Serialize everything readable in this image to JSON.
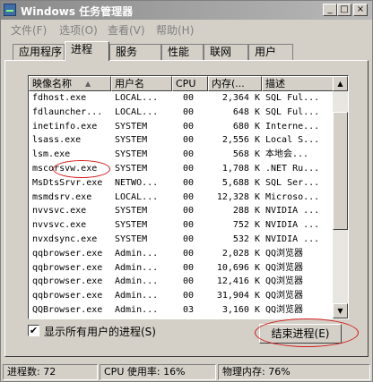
{
  "window": {
    "title": "Windows 任务管理器",
    "controls": {
      "minimize": "_",
      "maximize": "□",
      "close": "×"
    }
  },
  "menu": [
    "文件(F)",
    "选项(O)",
    "查看(V)",
    "帮助(H)"
  ],
  "tabs": [
    "应用程序",
    "进程",
    "服务",
    "性能",
    "联网",
    "用户"
  ],
  "active_tab": "进程",
  "table": {
    "columns": [
      "映像名称",
      "用户名",
      "CPU",
      "内存(...",
      "描述"
    ],
    "sort_indicator": "▲",
    "rows": [
      {
        "name": "fdhost.exe",
        "user": "LOCAL...",
        "cpu": "00",
        "mem": "2,364 K",
        "desc": "SQL Ful..."
      },
      {
        "name": "fdlauncher...",
        "user": "LOCAL...",
        "cpu": "00",
        "mem": "648 K",
        "desc": "SQL Ful..."
      },
      {
        "name": "inetinfo.exe",
        "user": "SYSTEM",
        "cpu": "00",
        "mem": "680 K",
        "desc": "Interne..."
      },
      {
        "name": "lsass.exe",
        "user": "SYSTEM",
        "cpu": "00",
        "mem": "2,556 K",
        "desc": "Local S..."
      },
      {
        "name": "lsm.exe",
        "user": "SYSTEM",
        "cpu": "00",
        "mem": "568 K",
        "desc": "本地会..."
      },
      {
        "name": "mscorsvw.exe",
        "user": "SYSTEM",
        "cpu": "00",
        "mem": "1,708 K",
        "desc": ".NET Ru..."
      },
      {
        "name": "MsDtsSrvr.exe",
        "user": "NETWO...",
        "cpu": "00",
        "mem": "5,688 K",
        "desc": "SQL Ser..."
      },
      {
        "name": "msmdsrv.exe",
        "user": "LOCAL...",
        "cpu": "00",
        "mem": "12,328 K",
        "desc": "Microso..."
      },
      {
        "name": "nvvsvc.exe",
        "user": "SYSTEM",
        "cpu": "00",
        "mem": "288 K",
        "desc": "NVIDIA ..."
      },
      {
        "name": "nvvsvc.exe",
        "user": "SYSTEM",
        "cpu": "00",
        "mem": "752 K",
        "desc": "NVIDIA ..."
      },
      {
        "name": "nvxdsync.exe",
        "user": "SYSTEM",
        "cpu": "00",
        "mem": "532 K",
        "desc": "NVIDIA ..."
      },
      {
        "name": "qqbrowser.exe",
        "user": "Admin...",
        "cpu": "00",
        "mem": "2,028 K",
        "desc": "QQ浏览器"
      },
      {
        "name": "qqbrowser.exe",
        "user": "Admin...",
        "cpu": "00",
        "mem": "10,696 K",
        "desc": "QQ浏览器"
      },
      {
        "name": "qqbrowser.exe",
        "user": "Admin...",
        "cpu": "00",
        "mem": "12,416 K",
        "desc": "QQ浏览器"
      },
      {
        "name": "qqbrowser.exe",
        "user": "Admin...",
        "cpu": "00",
        "mem": "31,904 K",
        "desc": "QQ浏览器"
      },
      {
        "name": "QQBrowser.exe",
        "user": "Admin...",
        "cpu": "03",
        "mem": "3,160 K",
        "desc": "QQ浏览器"
      }
    ]
  },
  "show_all_users": {
    "label": "显示所有用户的进程(S)",
    "checked": "✔"
  },
  "end_process_button": "结束进程(E)",
  "status": {
    "processes": "进程数: 72",
    "cpu": "CPU 使用率: 16%",
    "memory": "物理内存: 76%"
  },
  "annotation_color": "#d21919"
}
